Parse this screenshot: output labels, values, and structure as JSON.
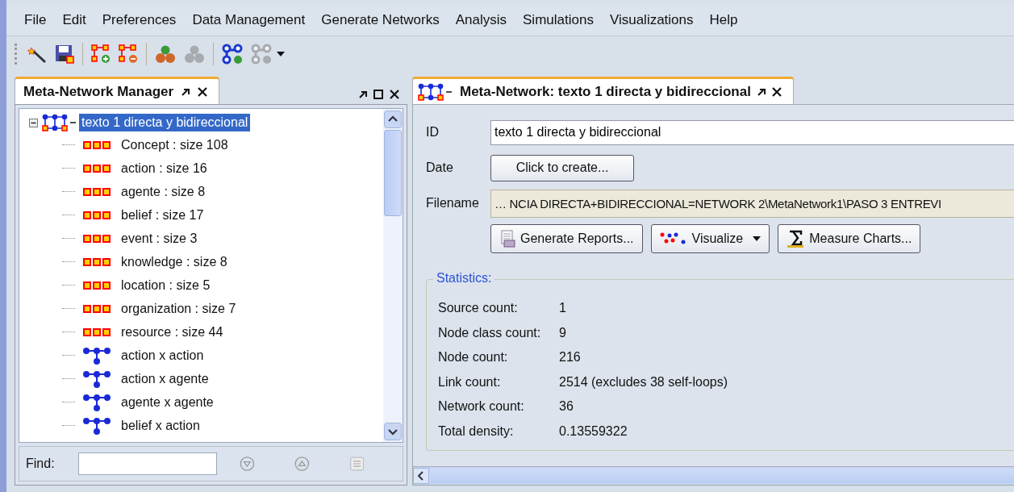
{
  "menu": [
    "File",
    "Edit",
    "Preferences",
    "Data Management",
    "Generate Networks",
    "Analysis",
    "Simulations",
    "Visualizations",
    "Help"
  ],
  "toolbar": [
    [
      {
        "kind": "wand",
        "disabled": false
      },
      {
        "kind": "save",
        "disabled": false
      }
    ],
    [
      {
        "kind": "add-class",
        "disabled": false
      },
      {
        "kind": "remove-class",
        "disabled": false
      }
    ],
    [
      {
        "kind": "group-add",
        "disabled": false
      },
      {
        "kind": "group",
        "disabled": true
      }
    ],
    [
      {
        "kind": "network-add",
        "disabled": false
      },
      {
        "kind": "network",
        "disabled": true
      },
      {
        "kind": "dropdown",
        "disabled": false
      }
    ]
  ],
  "left_panel": {
    "tab": {
      "title": "Meta-Network Manager",
      "selected": true
    },
    "tree": {
      "label": "texto 1 directa y bidireccional",
      "expanded": true,
      "selected": true,
      "children": [
        {
          "label": "Concept : size 108",
          "kind": "node-class",
          "selected": false
        },
        {
          "label": "action : size 16",
          "kind": "node-class",
          "selected": false
        },
        {
          "label": "agente : size 8",
          "kind": "node-class",
          "selected": false
        },
        {
          "label": "belief : size 17",
          "kind": "node-class",
          "selected": false
        },
        {
          "label": "event : size 3",
          "kind": "node-class",
          "selected": false
        },
        {
          "label": "knowledge : size 8",
          "kind": "node-class",
          "selected": false
        },
        {
          "label": "location : size 5",
          "kind": "node-class",
          "selected": false
        },
        {
          "label": "organization : size 7",
          "kind": "node-class",
          "selected": false
        },
        {
          "label": "resource : size 44",
          "kind": "node-class",
          "selected": false
        },
        {
          "label": "action x action",
          "kind": "network",
          "selected": false
        },
        {
          "label": "action x agente",
          "kind": "network",
          "selected": false
        },
        {
          "label": "agente x agente",
          "kind": "network",
          "selected": false
        },
        {
          "label": "belief x action",
          "kind": "network",
          "selected": false
        }
      ]
    },
    "find": {
      "label": "Find:"
    }
  },
  "right_panel": {
    "tab": {
      "title": "Meta-Network: texto 1 directa y bidireccional",
      "selected": true
    },
    "fields": {
      "id_label": "ID",
      "id_value": "texto 1 directa y bidireccional",
      "date_label": "Date",
      "date_button": "Click to create...",
      "filename_label": "Filename",
      "filename_value": "… NCIA DIRECTA+BIDIRECCIONAL=NETWORK 2\\MetaNetwork1\\PASO 3 ENTREVI"
    },
    "buttons": [
      {
        "label": "Generate Reports...",
        "kind": "reports",
        "dropdown": false
      },
      {
        "label": "Visualize",
        "kind": "visualize",
        "dropdown": true
      },
      {
        "label": "Measure Charts...",
        "kind": "measure",
        "dropdown": false
      }
    ],
    "statistics": {
      "title": "Statistics:",
      "rows": [
        {
          "label": "Source count:",
          "value": "1"
        },
        {
          "label": "Node class count:",
          "value": "9"
        },
        {
          "label": "Node count:",
          "value": "216"
        },
        {
          "label": "Link count:",
          "value": "2514 (excludes 38 self-loops)"
        },
        {
          "label": "Network count:",
          "value": "36"
        },
        {
          "label": "Total density:",
          "value": "0.13559322"
        }
      ]
    }
  }
}
